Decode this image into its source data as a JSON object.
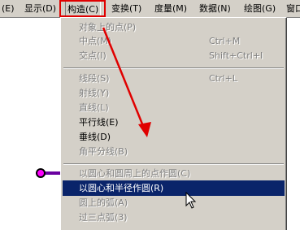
{
  "menubar": {
    "items": [
      {
        "label": "(E)"
      },
      {
        "label": "显示(D)"
      },
      {
        "label": "构造(C)"
      },
      {
        "label": "变换(T)"
      },
      {
        "label": "度量(M)"
      },
      {
        "label": "数据(N)"
      },
      {
        "label": "绘图(G)"
      },
      {
        "label": "窗口"
      }
    ]
  },
  "construct_menu": {
    "items": [
      {
        "label": "对象上的点(P)",
        "shortcut": "",
        "enabled": false
      },
      {
        "label": "中点(M)",
        "shortcut": "Ctrl+M",
        "enabled": false
      },
      {
        "label": "交点(I)",
        "shortcut": "Shift+Ctrl+I",
        "enabled": false
      },
      {
        "label": "线段(S)",
        "shortcut": "Ctrl+L",
        "enabled": false
      },
      {
        "label": "射线(Y)",
        "shortcut": "",
        "enabled": false
      },
      {
        "label": "直线(L)",
        "shortcut": "",
        "enabled": false
      },
      {
        "label": "平行线(E)",
        "shortcut": "",
        "enabled": true
      },
      {
        "label": "垂线(D)",
        "shortcut": "",
        "enabled": true
      },
      {
        "label": "角平分线(B)",
        "shortcut": "",
        "enabled": false
      },
      {
        "label": "以圆心和圆周上的点作圆(C)",
        "shortcut": "",
        "enabled": false
      },
      {
        "label": "以圆心和半径作圆(R)",
        "shortcut": "",
        "enabled": true,
        "highlighted": true
      },
      {
        "label": "圆上的弧(A)",
        "shortcut": "",
        "enabled": false
      },
      {
        "label": "过三点弧(3)",
        "shortcut": "",
        "enabled": false
      }
    ]
  },
  "colors": {
    "menu_bg": "#d4d0c8",
    "highlight": "#0a246a",
    "annotation_red": "#e00000",
    "point_magenta": "#ff00ff"
  }
}
